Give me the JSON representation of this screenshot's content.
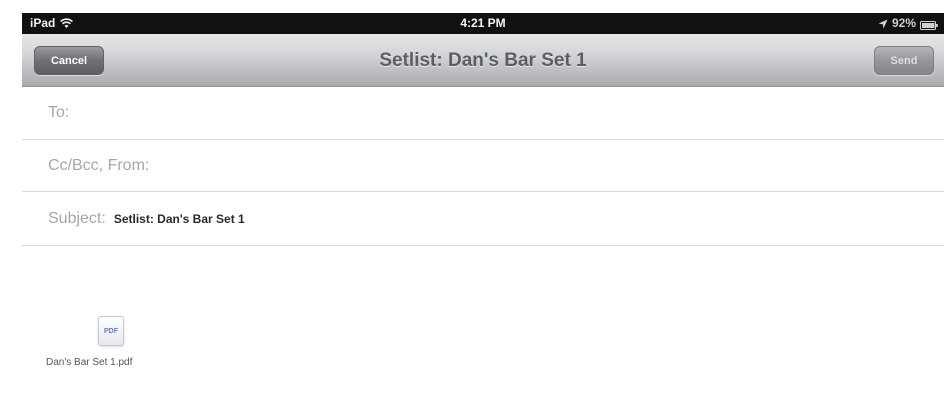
{
  "status_bar": {
    "device": "iPad",
    "time": "4:21 PM",
    "battery": "92%",
    "icons": [
      "wifi-icon",
      "location-icon",
      "battery-icon"
    ]
  },
  "nav_bar": {
    "cancel_label": "Cancel",
    "title": "Setlist: Dan's Bar Set 1",
    "send_label": "Send"
  },
  "compose": {
    "to_label": "To:",
    "cc_label": "Cc/Bcc, From:",
    "subject_label": "Subject:",
    "subject_value": "Setlist: Dan's Bar Set 1"
  },
  "attachment": {
    "icon_label": "PDF",
    "file_name": "Dan's Bar Set 1.pdf",
    "icon": "pdf-file-icon"
  },
  "colors": {
    "nav_gradient_top": "#e8e8ea",
    "nav_gradient_bottom": "#a8aaae",
    "label_gray": "#a7a7a7",
    "title_gray": "#5b5e63"
  }
}
